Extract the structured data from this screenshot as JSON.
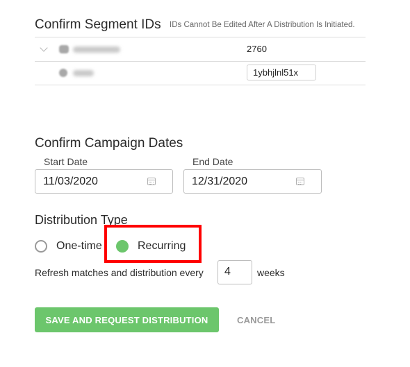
{
  "segments": {
    "title": "Confirm Segment IDs",
    "note": "IDs Cannot Be Edited After A Distribution Is Initiated.",
    "rows": [
      {
        "icon": "people-icon",
        "value": "2760"
      },
      {
        "icon": "pie-chart-icon",
        "value": "1ybhjlnl51x"
      }
    ]
  },
  "dates": {
    "title": "Confirm Campaign Dates",
    "start_label": "Start Date",
    "start_value": "11/03/2020",
    "end_label": "End Date",
    "end_value": "12/31/2020"
  },
  "distribution": {
    "title": "Distribution Type",
    "options": [
      {
        "label": "One-time",
        "selected": false
      },
      {
        "label": "Recurring",
        "selected": true
      }
    ],
    "refresh_prefix": "Refresh matches and distribution every",
    "refresh_value": "4",
    "refresh_suffix": "weeks"
  },
  "actions": {
    "save_label": "SAVE AND REQUEST DISTRIBUTION",
    "cancel_label": "CANCEL"
  },
  "colors": {
    "accent_green": "#6cc66c",
    "highlight_red": "#ff0000"
  }
}
